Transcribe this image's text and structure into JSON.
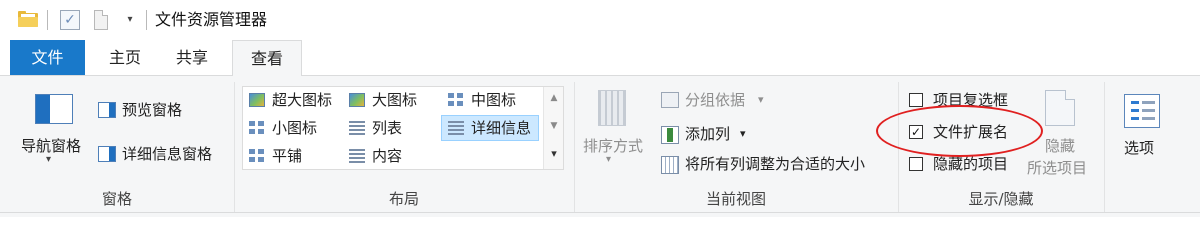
{
  "window": {
    "title": "文件资源管理器",
    "quick_access_dropdown": "▾"
  },
  "tabs": {
    "file": "文件",
    "home": "主页",
    "share": "共享",
    "view": "查看",
    "active": "查看"
  },
  "groups": {
    "panes": {
      "label": "窗格",
      "navigation_pane": "导航窗格",
      "navigation_pane_arrow": "▾",
      "preview_pane": "预览窗格",
      "details_pane": "详细信息窗格"
    },
    "layout": {
      "label": "布局",
      "items": [
        {
          "label": "超大图标",
          "icon": "extra-large-icons-icon"
        },
        {
          "label": "大图标",
          "icon": "large-icons-icon"
        },
        {
          "label": "中图标",
          "icon": "medium-icons-icon"
        },
        {
          "label": "小图标",
          "icon": "small-icons-icon"
        },
        {
          "label": "列表",
          "icon": "list-icon"
        },
        {
          "label": "详细信息",
          "icon": "details-icon",
          "selected": true
        },
        {
          "label": "平铺",
          "icon": "tiles-icon"
        },
        {
          "label": "内容",
          "icon": "content-icon"
        }
      ],
      "scroll_up": "▲",
      "scroll_down": "▼",
      "expand": "▾"
    },
    "current_view": {
      "label": "当前视图",
      "sort_by": "排序方式",
      "sort_by_arrow": "▾",
      "group_by": "分组依据",
      "group_by_arrow": "▾",
      "add_columns": "添加列",
      "add_columns_arrow": "▾",
      "size_columns": "将所有列调整为合适的大小"
    },
    "show_hide": {
      "label": "显示/隐藏",
      "item_checkboxes": {
        "label": "项目复选框",
        "checked": false
      },
      "file_extensions": {
        "label": "文件扩展名",
        "checked": true
      },
      "hidden_items": {
        "label": "隐藏的项目",
        "checked": false
      },
      "hide_selected": "隐藏",
      "hide_selected_line2": "所选项目",
      "check_mark": "✓"
    },
    "options": {
      "label": "选项"
    }
  },
  "annotation": {
    "color": "#e02020",
    "target": "file_extensions"
  },
  "colors": {
    "file_tab": "#1979ca",
    "ribbon_bg": "#f5f6f7",
    "selected_layout": "#cce8ff"
  }
}
